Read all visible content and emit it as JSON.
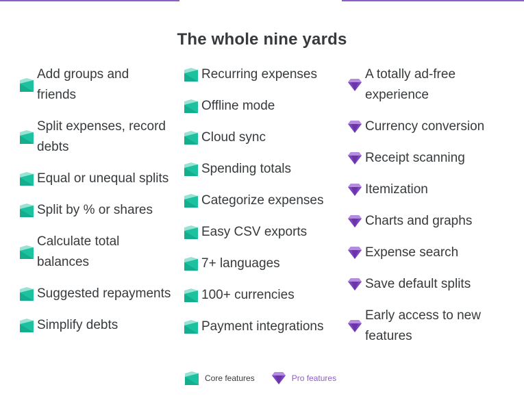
{
  "title": "The whole nine yards",
  "colors": {
    "core_accent": "#1cc29f",
    "pro_accent": "#7d44c0",
    "pro_text": "#8b5fc7",
    "top_line": "#8b5fc7"
  },
  "columns": [
    {
      "icon": "core-feature-icon",
      "items": [
        "Add groups and friends",
        "Split expenses, record debts",
        "Equal or unequal splits",
        "Split by % or shares",
        "Calculate total balances",
        "Suggested repayments",
        "Simplify debts"
      ]
    },
    {
      "icon": "core-feature-icon",
      "items": [
        "Recurring expenses",
        "Offline mode",
        "Cloud sync",
        "Spending totals",
        "Categorize expenses",
        "Easy CSV exports",
        "7+ languages",
        "100+ currencies",
        "Payment integrations"
      ]
    },
    {
      "icon": "pro-feature-gem-icon",
      "items": [
        "A totally ad-free experience",
        "Currency conversion",
        "Receipt scanning",
        "Itemization",
        "Charts and graphs",
        "Expense search",
        "Save default splits",
        "Early access to new features"
      ]
    }
  ],
  "legend": {
    "core_label": "Core features",
    "pro_label": "Pro features"
  }
}
